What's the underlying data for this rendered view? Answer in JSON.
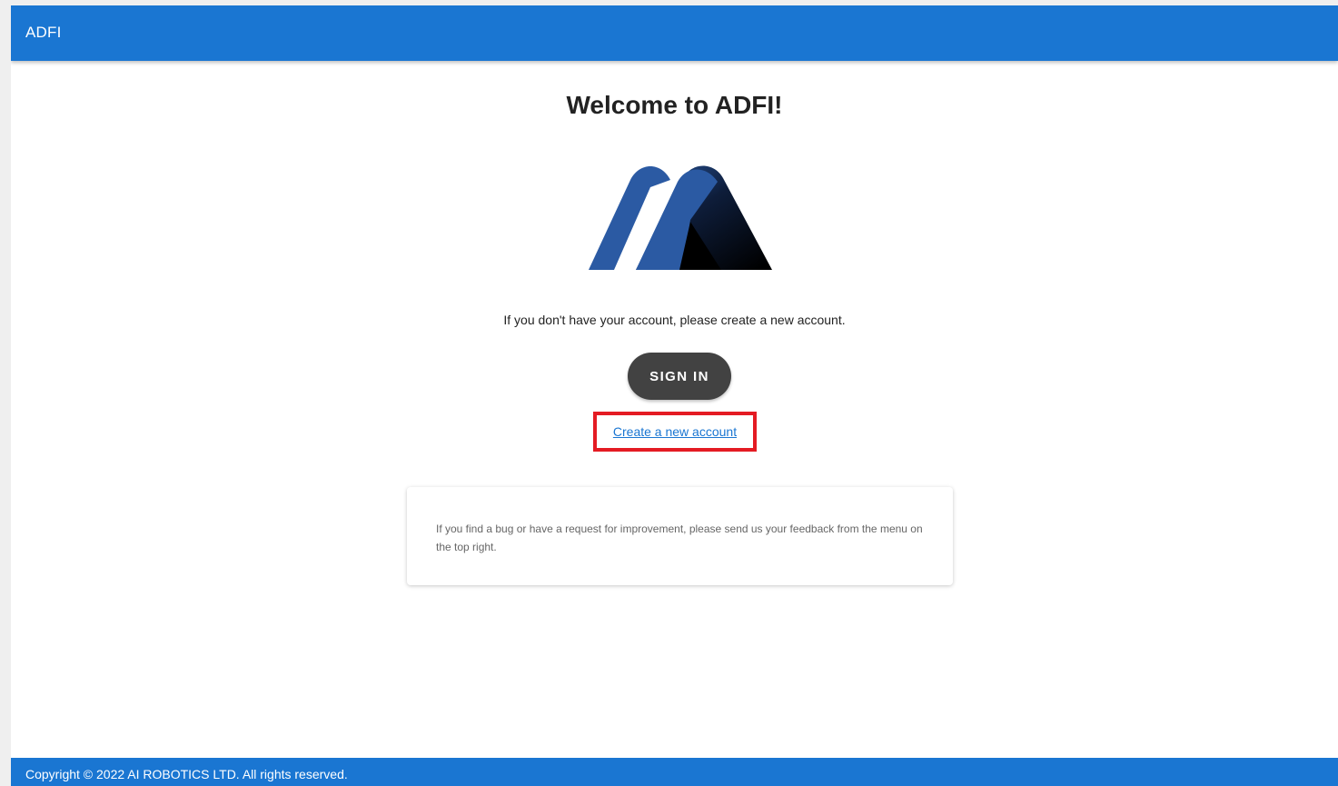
{
  "header": {
    "title": "ADFI"
  },
  "main": {
    "welcome": "Welcome to ADFI!",
    "intro": "If you don't have your account, please create a new account.",
    "sign_in_label": "SIGN IN",
    "create_account_label": "Create a new account",
    "feedback_text": "If you find a bug or have a request for improvement, please send us your feedback from the menu on the top right."
  },
  "footer": {
    "copyright": "Copyright © 2022 AI ROBOTICS LTD. All rights reserved."
  },
  "colors": {
    "primary": "#1a76d2",
    "button": "#424242",
    "highlight": "#e41b23",
    "logo_blue": "#2b5aa3",
    "logo_dark": "#000000"
  },
  "icons": {
    "logo": "adfi-logo-icon"
  }
}
